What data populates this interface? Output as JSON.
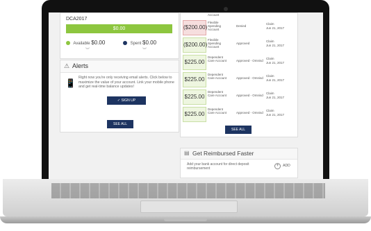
{
  "card": {
    "title": "DCA2017",
    "bar_amount": "$0.00",
    "available_label": "Available",
    "available_amount": "$0.00",
    "spent_label": "Spent",
    "spent_amount": "$0.00",
    "available_color": "#8dc63f",
    "spent_color": "#1d3461"
  },
  "alerts": {
    "title": "Alerts",
    "text": "Right now you're only receiving email alerts. Click below to maximize the value of your account. Link your mobile phone and get real-time balance updates!",
    "signup_label": "SIGN UP",
    "see_all_label": "SEE ALL"
  },
  "transactions": {
    "top_partial": "Account",
    "rows": [
      {
        "amount": "($200.00)",
        "type": "Flexible Spending Account",
        "status": "Denied",
        "claim": "Claim",
        "date": "Jun 21, 2017"
      },
      {
        "amount": "($200.00)",
        "type": "Flexible Spending Account",
        "status": "Approved",
        "claim": "Claim",
        "date": "Jun 21, 2017"
      },
      {
        "amount": "$225.00",
        "type": "Dependent Care Account",
        "status": "Approved - Omnisd",
        "claim": "Claim",
        "date": "Jun 21, 2017"
      },
      {
        "amount": "$225.00",
        "type": "Dependent Care Account",
        "status": "Approved - Omnisd",
        "claim": "Claim",
        "date": "Jun 21, 2017"
      },
      {
        "amount": "$225.00",
        "type": "Dependent Care Account",
        "status": "Approved - Omnisd",
        "claim": "Claim",
        "date": "Jun 21, 2017"
      },
      {
        "amount": "$225.00",
        "type": "Dependent Care Account",
        "status": "Approved - Omnisd",
        "claim": "Claim",
        "date": "Jun 21, 2017"
      }
    ],
    "see_all_label": "SEE ALL"
  },
  "reimburse": {
    "title": "Get Reimbursed Faster",
    "text": "Add your bank account for direct deposit reimbursement",
    "add_label": "ADD"
  }
}
